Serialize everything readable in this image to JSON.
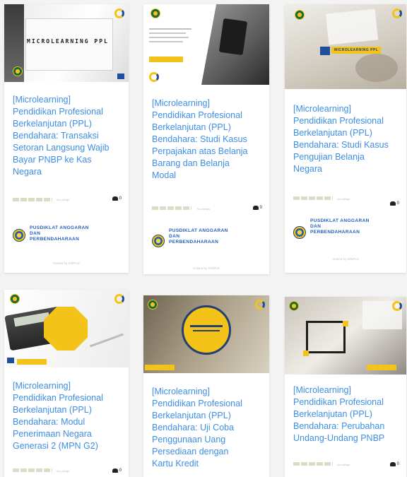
{
  "cards": [
    {
      "thumb_label": "MICROLEARNING PPL",
      "title": "[Microlearning]\nPendidikan Profesional\nBerkelanjutan (PPL)\nBendahara: Transaksi\nSetoran Langsung Wajib\nBayar PNBP ke Kas\nNegara",
      "rating_text": "No ratings",
      "learners": "0",
      "provider": "PUSDIKLAT ANGGARAN\nDAN\nPERBENDAHARAAN",
      "hosted": "Hosted by SIMPLE"
    },
    {
      "thumb_label": "",
      "title": "[Microlearning]\nPendidikan Profesional\nBerkelanjutan (PPL)\nBendahara: Studi Kasus\nPerpajakan atas Belanja\nBarang dan Belanja\nModal",
      "rating_text": "No ratings",
      "learners": "0",
      "provider": "PUSDIKLAT ANGGARAN\nDAN\nPERBENDAHARAAN",
      "hosted": "Hosted by SIMPLE"
    },
    {
      "thumb_label": "MICROLEARNING PPL",
      "title": "[Microlearning]\nPendidikan Profesional\nBerkelanjutan (PPL)\nBendahara: Studi Kasus\nPengujian Belanja\nNegara",
      "rating_text": "No ratings",
      "learners": "0",
      "provider": "PUSDIKLAT ANGGARAN\nDAN\nPERBENDAHARAAN",
      "hosted": "Hosted by SIMPLE"
    },
    {
      "thumb_label": "",
      "title": "[Microlearning]\nPendidikan Profesional\nBerkelanjutan (PPL)\nBendahara: Modul\nPenerimaan Negara\nGenerasi 2 (MPN G2)",
      "rating_text": "No ratings",
      "learners": "0"
    },
    {
      "thumb_label": "",
      "title": "[Microlearning]\nPendidikan Profesional\nBerkelanjutan (PPL)\nBendahara: Uji Coba\nPenggunaan Uang\nPersediaan dengan\nKartu Kredit",
      "rating_text": "",
      "learners": ""
    },
    {
      "thumb_label": "",
      "title": "[Microlearning]\nPendidikan Profesional\nBerkelanjutan (PPL)\nBendahara: Perubahan\nUndang-Undang PNBP",
      "rating_text": "No ratings",
      "learners": "0"
    }
  ],
  "colors": {
    "title": "#3d8ee6",
    "provider": "#1f5fbf",
    "accent": "#f3c319",
    "navy": "#1c3f7a"
  }
}
